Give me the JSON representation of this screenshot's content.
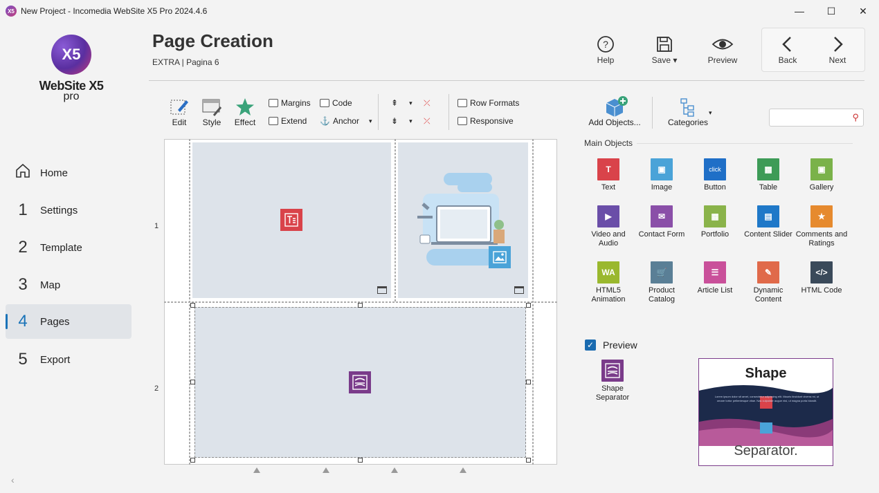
{
  "window": {
    "title": "New Project - Incomedia WebSite X5 Pro 2024.4.6",
    "app_icon": "X5"
  },
  "logo": {
    "mark": "X5",
    "name": "WebSite X5",
    "edition": "pro"
  },
  "sidebar": {
    "items": [
      {
        "num": "",
        "label": "Home",
        "icon": "home-icon"
      },
      {
        "num": "1",
        "label": "Settings"
      },
      {
        "num": "2",
        "label": "Template"
      },
      {
        "num": "3",
        "label": "Map"
      },
      {
        "num": "4",
        "label": "Pages",
        "active": true
      },
      {
        "num": "5",
        "label": "Export"
      }
    ]
  },
  "header": {
    "title": "Page Creation",
    "subtitle": "EXTRA | Pagina 6",
    "buttons": {
      "help": "Help",
      "save": "Save",
      "preview": "Preview",
      "back": "Back",
      "next": "Next"
    }
  },
  "toolbar": {
    "edit": "Edit",
    "style": "Style",
    "effect": "Effect",
    "margins": "Margins",
    "extend": "Extend",
    "code": "Code",
    "anchor": "Anchor",
    "row_formats": "Row Formats",
    "responsive": "Responsive",
    "add_objects": "Add Objects...",
    "categories": "Categories"
  },
  "canvas": {
    "rows": [
      "1",
      "2"
    ]
  },
  "objects": {
    "section": "Main Objects",
    "items": [
      {
        "label": "Text",
        "color": "#d9434a",
        "glyph": "T"
      },
      {
        "label": "Image",
        "color": "#4aa3d8",
        "glyph": "▣"
      },
      {
        "label": "Button",
        "color": "#1f6fc7",
        "glyph": "click"
      },
      {
        "label": "Table",
        "color": "#3d9b57",
        "glyph": "▦"
      },
      {
        "label": "Gallery",
        "color": "#7ab24a",
        "glyph": "▣"
      },
      {
        "label": "Video and Audio",
        "color": "#6a4ea8",
        "glyph": "▶"
      },
      {
        "label": "Contact Form",
        "color": "#8a4fa8",
        "glyph": "✉"
      },
      {
        "label": "Portfolio",
        "color": "#8ab34a",
        "glyph": "▦"
      },
      {
        "label": "Content Slider",
        "color": "#1f78c8",
        "glyph": "▤"
      },
      {
        "label": "Comments and Ratings",
        "color": "#e68a2e",
        "glyph": "★"
      },
      {
        "label": "HTML5 Animation",
        "color": "#9ab82e",
        "glyph": "WA"
      },
      {
        "label": "Product Catalog",
        "color": "#5a7f96",
        "glyph": "🛒"
      },
      {
        "label": "Article List",
        "color": "#c9509a",
        "glyph": "☰"
      },
      {
        "label": "Dynamic Content",
        "color": "#e06a4a",
        "glyph": "✎"
      },
      {
        "label": "HTML Code",
        "color": "#3a4a5a",
        "glyph": "</>"
      }
    ]
  },
  "preview": {
    "label": "Preview",
    "selected_object": "Shape Separator",
    "image_title": "Shape",
    "image_caption": "Separator.",
    "image_body": "Lorem ipsum dolor sit amet, consectetur adipiscing elit. Mauris tincidunt viverra mi, ut ornare tortor pellentesque vitae. Nas vulputate augue nisi, ut magna porta blandit."
  },
  "colors": {
    "accent": "#1a73b8",
    "text_obj": "#d9434a",
    "shape_obj": "#7a3b8a"
  }
}
